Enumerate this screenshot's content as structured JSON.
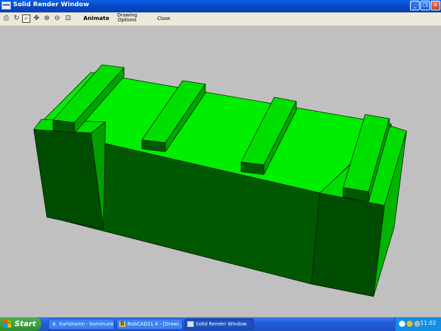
{
  "window": {
    "title": "Solid Render Window",
    "minimize_glyph": "_",
    "maximize_glyph": "❐",
    "close_glyph": "✕"
  },
  "toolbar": {
    "icons": [
      "print-icon",
      "redraw-icon",
      "zoom-window-icon",
      "pan-icon",
      "zoom-in-icon",
      "zoom-out-icon",
      "zoom-extents-icon"
    ],
    "animate_label": "Animate",
    "drawing_options_line1": "Drawing",
    "drawing_options_line2": "Options",
    "close_label": "Close"
  },
  "render": {
    "object": "wooden-crate-solid-model",
    "colors": {
      "background": "#c0c0c0",
      "top_face": "#00ee00",
      "front_face": "#005800",
      "side_face": "#00b400",
      "edge": "#001a00"
    }
  },
  "taskbar": {
    "start_label": "Start",
    "tasks": [
      {
        "label": "Karlshamn - kommune...",
        "icon": "ie-icon"
      },
      {
        "label": "BobCAD21.4 - [Drawi...",
        "icon": "bobcad-icon"
      },
      {
        "label": "Solid Render Window",
        "icon": "render-window-icon"
      }
    ],
    "clock": "11:02"
  }
}
